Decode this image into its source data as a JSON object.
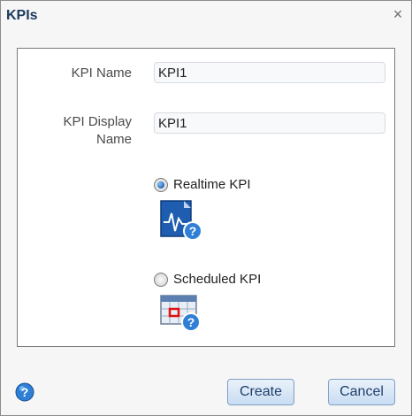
{
  "dialog": {
    "title": "KPIs",
    "close_glyph": "×"
  },
  "form": {
    "kpi_name_label": "KPI Name",
    "kpi_name_value": "KPI1",
    "kpi_display_label_line1": "KPI Display",
    "kpi_display_label_line2": "Name",
    "kpi_display_value": "KPI1",
    "options": [
      {
        "label": "Realtime KPI",
        "selected": true,
        "icon": "realtime-kpi-icon"
      },
      {
        "label": "Scheduled KPI",
        "selected": false,
        "icon": "scheduled-kpi-icon"
      }
    ]
  },
  "footer": {
    "help_icon": "help-icon",
    "create_label": "Create",
    "cancel_label": "Cancel"
  },
  "colors": {
    "accent": "#1f5aa3",
    "title": "#1b3b5c",
    "button_text": "#1f3f6a"
  }
}
